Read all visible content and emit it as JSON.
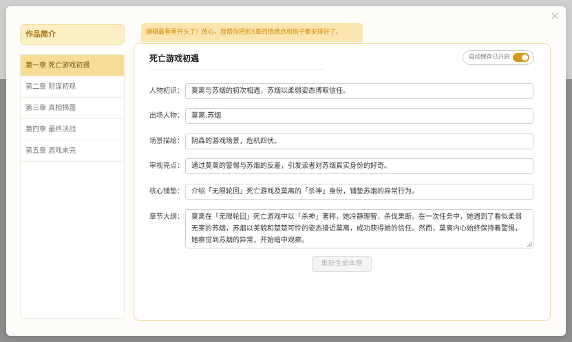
{
  "close_icon": "×",
  "sidebar": {
    "title": "作品简介",
    "chapters": [
      {
        "label": "第一章 死亡游戏初遇",
        "active": true
      },
      {
        "label": "第二章 阴谋初现"
      },
      {
        "label": "第三章 真相揭露"
      },
      {
        "label": "第四章 最终决战"
      },
      {
        "label": "第五章 游戏未完"
      }
    ]
  },
  "notice": "编辑最看重开头了！放心，我帮你把前5章的情绪点和钩子都安排好了。",
  "panel": {
    "chapter_title": "死亡游戏初遇",
    "autosave": {
      "label": "自动保存已开启",
      "enabled": true
    },
    "fields": [
      {
        "label": "人物初识：",
        "value": "莫离与苏烟的初次相遇，苏烟以柔弱姿态博取信任。"
      },
      {
        "label": "出场人物：",
        "value": "莫离,苏烟"
      },
      {
        "label": "场景描绘：",
        "value": "阴森的游戏场景，危机四伏。"
      },
      {
        "label": "审视亮点：",
        "value": "通过莫离的警惕与苏烟的反差，引发读者对苏烟真实身份的好奇。"
      },
      {
        "label": "核心铺垫：",
        "value": "介绍「无限轮回」死亡游戏及莫离的「杀神」身份，铺垫苏烟的异常行为。"
      }
    ],
    "outline": {
      "label": "章节大纲：",
      "value": "莫离在「无限轮回」死亡游戏中以「杀神」著称，她冷静理智，杀伐果断。在一次任务中，她遇到了看似柔弱无辜的苏烟，苏烟以美貌和楚楚可怜的姿态接近莫离，成功获得她的信任。然而，莫离内心始终保持着警惕，她察觉到苏烟的异常，开始暗中观察。"
    },
    "regenerate_label": "重新生成本章"
  },
  "colors": {
    "accent": "#d49a1c",
    "notice_text": "#d48a05",
    "active_item": "#f5dd93",
    "panel_border": "#f3dc98"
  }
}
